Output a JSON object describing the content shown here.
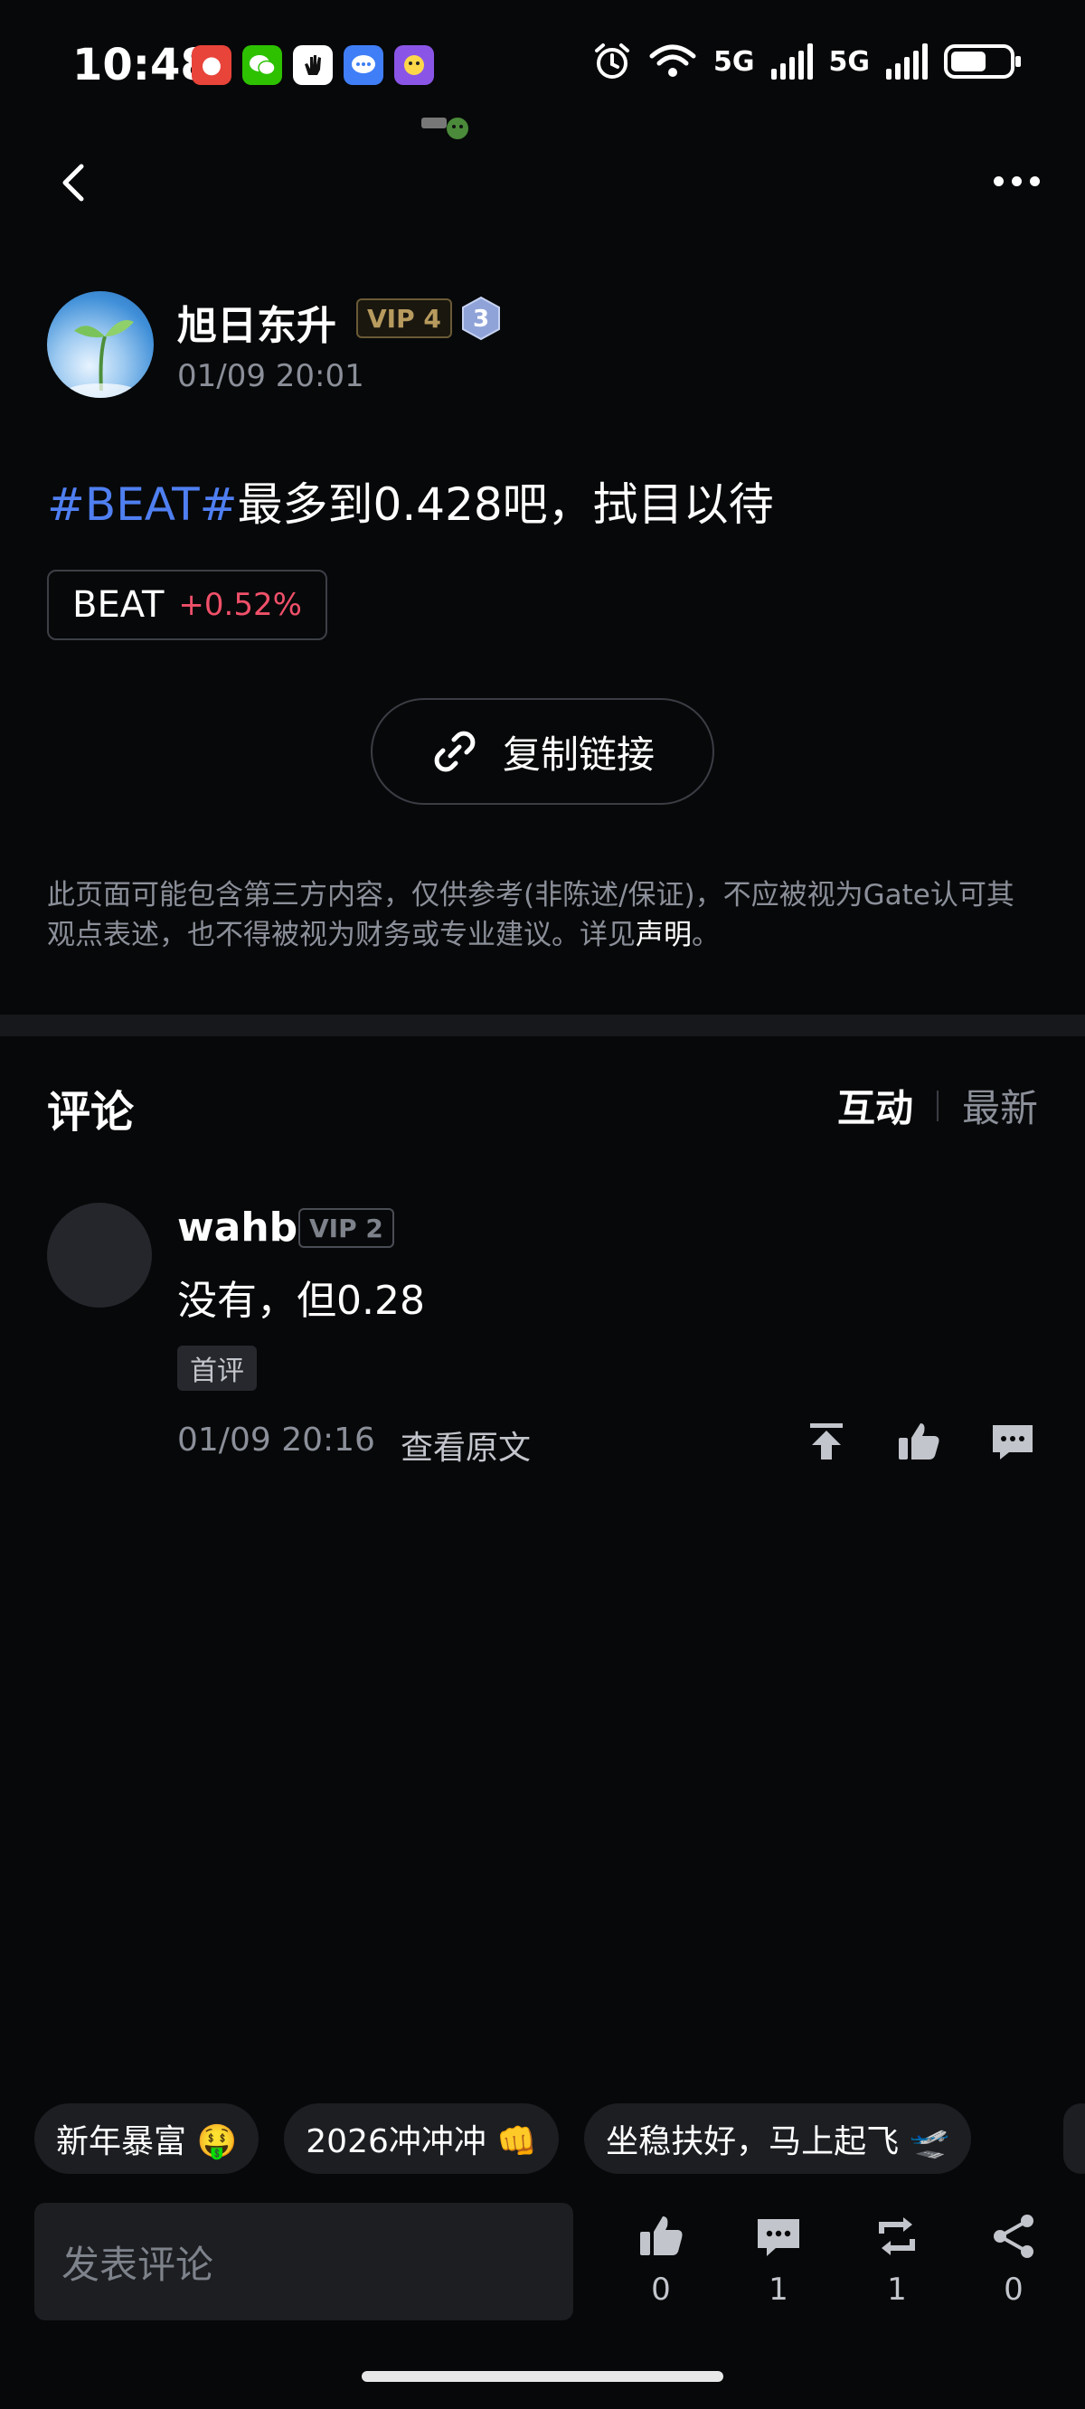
{
  "status_bar": {
    "time": "10:48",
    "network_1": "5G",
    "network_2": "5G",
    "app_icons": [
      "red-app-icon",
      "wechat-icon",
      "hand-app-icon",
      "message-app-icon",
      "game-app-icon"
    ]
  },
  "nav": {
    "back_icon": "chevron-left-icon",
    "more_icon": "more-horizontal-icon"
  },
  "post": {
    "author_name": "旭日东升",
    "author_vip": "VIP 4",
    "author_level": "3",
    "timestamp": "01/09 20:01",
    "hashtag": "#BEAT#",
    "text": "最多到0.428吧，拭目以待",
    "coin": {
      "symbol": "BEAT",
      "change": "+0.52%",
      "change_color": "#f0506a"
    },
    "copy_link_label": "复制链接"
  },
  "disclaimer": {
    "text": "此页面可能包含第三方内容，仅供参考(非陈述/保证)，不应被视为Gate认可其观点表述，也不得被视为财务或专业建议。详见",
    "link": "声明",
    "suffix": "。"
  },
  "comments": {
    "title": "评论",
    "sort_active": "互动",
    "sort_inactive": "最新",
    "items": [
      {
        "user": "wahb",
        "vip": "VIP 2",
        "text": "没有，但0.28",
        "tag": "首评",
        "timestamp": "01/09 20:16",
        "view_original": "查看原文"
      }
    ]
  },
  "quick_replies": [
    "新年暴富 🤑",
    "2026冲冲冲 👊",
    "坐稳扶好，马上起飞 🛫"
  ],
  "bottom_bar": {
    "input_placeholder": "发表评论",
    "like_count": "0",
    "comment_count": "1",
    "repost_count": "1",
    "share_count": "0"
  },
  "colors": {
    "background": "#070809",
    "hashtag": "#4f7ff1",
    "vip_gold": "#b79b5e",
    "muted_text": "#8b8f99"
  }
}
